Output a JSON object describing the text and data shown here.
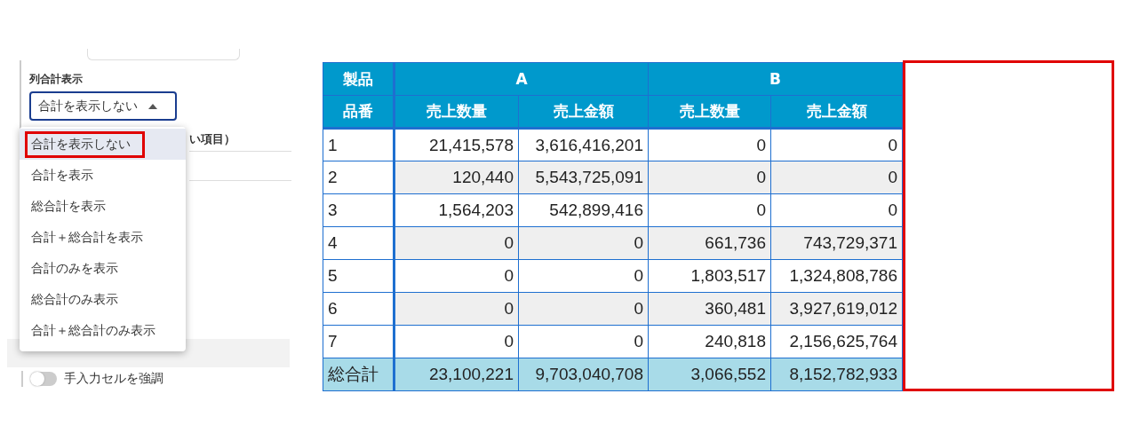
{
  "settings_panel": {
    "behind_label": "い項目）",
    "column_total": {
      "label": "列合計表示",
      "value": "合計を表示しない",
      "expanded": true,
      "options": [
        {
          "label": "合計を表示しない",
          "selected": true,
          "marked": true
        },
        {
          "label": "合計を表示",
          "selected": false,
          "marked": false
        },
        {
          "label": "総合計を表示",
          "selected": false,
          "marked": false
        },
        {
          "label": "合計＋総合計を表示",
          "selected": false,
          "marked": false
        },
        {
          "label": "合計のみを表示",
          "selected": false,
          "marked": false
        },
        {
          "label": "総合計のみ表示",
          "selected": false,
          "marked": false
        },
        {
          "label": "合計＋総合計のみ表示",
          "selected": false,
          "marked": false
        }
      ]
    },
    "highlight_toggle": {
      "label": "手入力セルを強調",
      "on": false
    }
  },
  "table": {
    "groups": [
      "製品",
      "A",
      "B"
    ],
    "columns": [
      "品番",
      "売上数量",
      "売上金額",
      "売上数量",
      "売上金額"
    ],
    "rows": [
      {
        "kind": "data",
        "cells": [
          "1",
          "21,415,578",
          "3,616,416,201",
          "0",
          "0"
        ]
      },
      {
        "kind": "data",
        "cells": [
          "2",
          "120,440",
          "5,543,725,091",
          "0",
          "0"
        ]
      },
      {
        "kind": "data",
        "cells": [
          "3",
          "1,564,203",
          "542,899,416",
          "0",
          "0"
        ]
      },
      {
        "kind": "data",
        "cells": [
          "4",
          "0",
          "0",
          "661,736",
          "743,729,371"
        ]
      },
      {
        "kind": "data",
        "cells": [
          "5",
          "0",
          "0",
          "1,803,517",
          "1,324,808,786"
        ]
      },
      {
        "kind": "data",
        "cells": [
          "6",
          "0",
          "0",
          "360,481",
          "3,927,619,012"
        ]
      },
      {
        "kind": "data",
        "cells": [
          "7",
          "0",
          "0",
          "240,818",
          "2,156,625,764"
        ]
      },
      {
        "kind": "total",
        "cells": [
          "総合計",
          "23,100,221",
          "9,703,040,708",
          "3,066,552",
          "8,152,782,933"
        ]
      }
    ],
    "callout_frame": true
  }
}
